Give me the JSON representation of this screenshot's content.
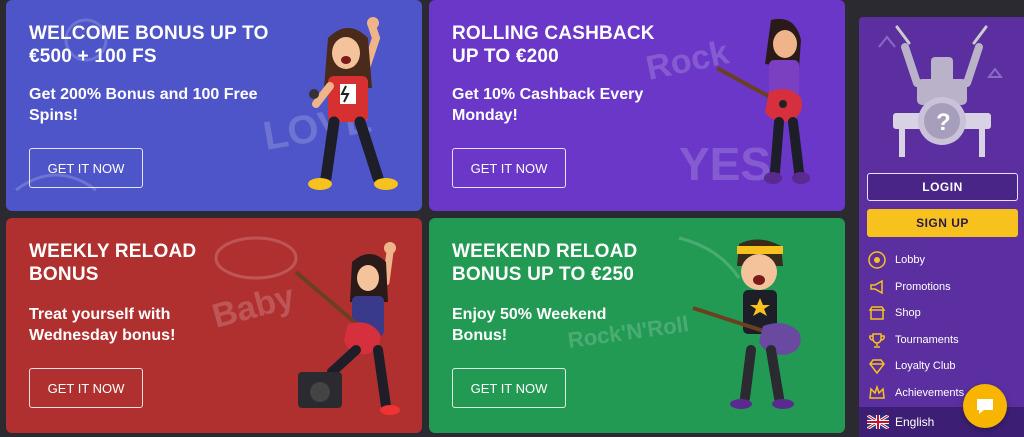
{
  "cards": [
    {
      "title": "WELCOME BONUS UP TO\n€500 + 100 FS",
      "desc": "Get 200% Bonus and 100 Free\nSpins!",
      "button": "GET IT NOW"
    },
    {
      "title": "ROLLING CASHBACK\nUP TO €200",
      "desc": "Get 10% Cashback Every\nMonday!",
      "button": "GET IT NOW"
    },
    {
      "title": "WEEKLY RELOAD\nBONUS",
      "desc": "Treat yourself with\nWednesday bonus!",
      "button": "GET IT NOW"
    },
    {
      "title": "WEEKEND RELOAD\nBONUS UP TO €250",
      "desc": "Enjoy 50% Weekend\nBonus!",
      "button": "GET IT NOW"
    }
  ],
  "sidebar": {
    "login": "LOGIN",
    "signup": "SIGN UP",
    "items": [
      {
        "label": "Lobby",
        "icon": "vinyl-record-icon"
      },
      {
        "label": "Promotions",
        "icon": "megaphone-icon"
      },
      {
        "label": "Shop",
        "icon": "shop-icon"
      },
      {
        "label": "Tournaments",
        "icon": "trophy-icon"
      },
      {
        "label": "Loyalty Club",
        "icon": "diamond-icon"
      },
      {
        "label": "Achievements",
        "icon": "crown-icon"
      }
    ],
    "language": "English"
  },
  "colors": {
    "welcome": "#4e55c9",
    "cashback": "#6a37c8",
    "weekly": "#b0302f",
    "weekend": "#239a54",
    "sidebar": "#5b2fa0",
    "signup": "#f7c21e",
    "chat": "#f7b500"
  }
}
